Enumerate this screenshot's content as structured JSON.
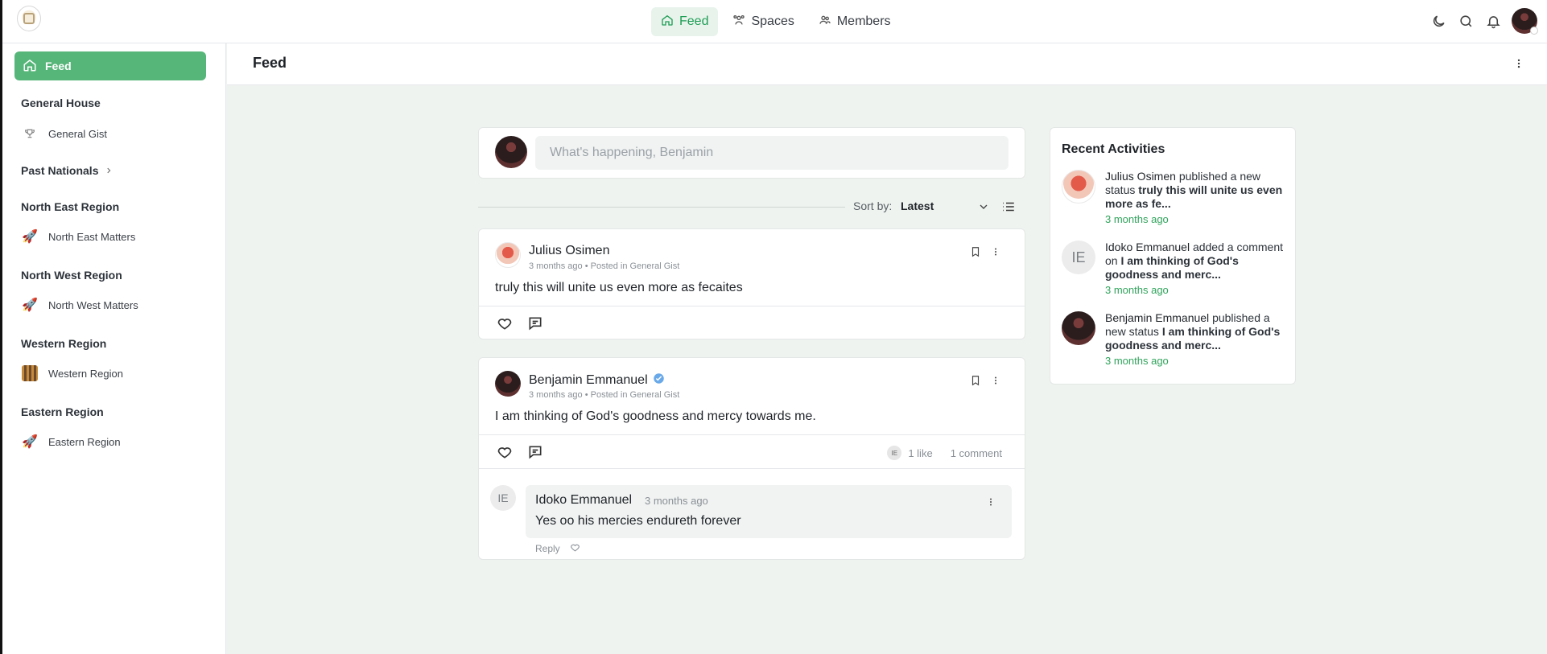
{
  "topnav": {
    "items": [
      {
        "label": "Feed",
        "icon": "home-icon",
        "active": true
      },
      {
        "label": "Spaces",
        "icon": "spaces-icon",
        "active": false
      },
      {
        "label": "Members",
        "icon": "members-icon",
        "active": false
      }
    ],
    "icons": [
      "moon-icon",
      "search-icon",
      "bell-icon",
      "profile-avatar"
    ]
  },
  "sidebar": {
    "feed_label": "Feed",
    "groups": [
      {
        "label": "General House",
        "items": [
          {
            "label": "General Gist",
            "icon": "trophy-icon"
          }
        ]
      },
      {
        "label": "Past Nationals",
        "items": []
      },
      {
        "label": "North East Region",
        "items": [
          {
            "label": "North East Matters",
            "icon": "rocket-icon"
          }
        ]
      },
      {
        "label": "North West Region",
        "items": [
          {
            "label": "North West Matters",
            "icon": "rocket-icon"
          }
        ]
      },
      {
        "label": "Western Region",
        "items": [
          {
            "label": "Western Region",
            "icon": "image-icon"
          }
        ]
      },
      {
        "label": "Eastern Region",
        "items": [
          {
            "label": "Eastern Region",
            "icon": "rocket-icon"
          }
        ]
      }
    ]
  },
  "main": {
    "title": "Feed",
    "composer_placeholder": "What's happening, Benjamin",
    "sort_label": "Sort by:",
    "sort_value": "Latest"
  },
  "posts": [
    {
      "author": "Julius Osimen",
      "meta": "3 months ago • Posted in General Gist",
      "body": "truly this will unite us even more as fecaites"
    },
    {
      "author": "Benjamin Emmanuel",
      "verified": true,
      "meta": "3 months ago • Posted in General Gist",
      "body": "I am thinking of God's goodness and mercy towards me.",
      "likes": "1 like",
      "comments_count": "1 comment",
      "liker_initials": "IE",
      "comment": {
        "initials": "IE",
        "author": "Idoko Emmanuel",
        "time": "3 months ago",
        "text": "Yes oo his mercies endureth forever",
        "reply_label": "Reply"
      }
    }
  ],
  "recent": {
    "title": "Recent Activities",
    "items": [
      {
        "actor": "Julius Osimen",
        "action": "published a new status",
        "target": "truly this will unite us even more as fe...",
        "time": "3 months ago"
      },
      {
        "initials": "IE",
        "actor": "Idoko Emmanuel",
        "action": "added a comment on",
        "target": "I am thinking of God's goodness and merc...",
        "time": "3 months ago"
      },
      {
        "actor": "Benjamin Emmanuel",
        "action": "published a new status",
        "target": "I am thinking of God's goodness and merc...",
        "time": "3 months ago"
      }
    ]
  },
  "colors": {
    "accent": "#56b679",
    "accent_text": "#1f9d55",
    "page_bg": "#eff3f0",
    "time_green": "#31a35c"
  }
}
